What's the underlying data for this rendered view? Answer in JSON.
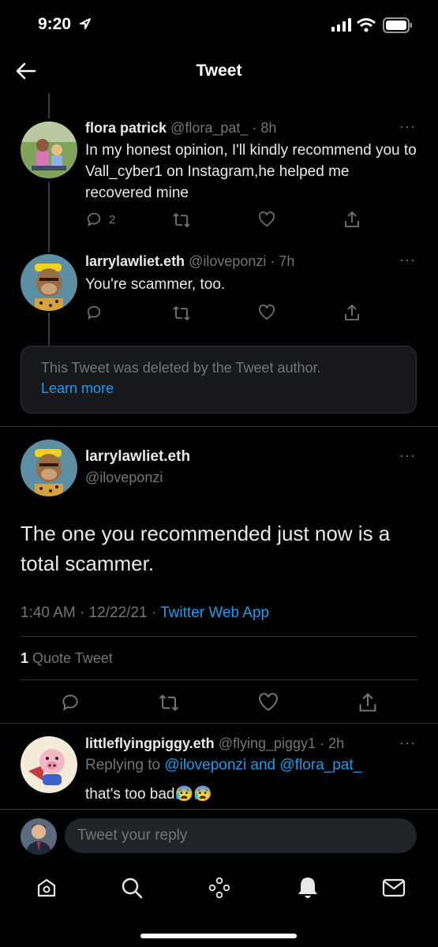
{
  "status": {
    "time": "9:20"
  },
  "header": {
    "title": "Tweet"
  },
  "tweets": [
    {
      "name": "flora patrick",
      "handle": "@flora_pat_",
      "time": "· 8h",
      "body": "In my honest opinion, I'll kindly recommend you to Vall_cyber1 on Instagram,he helped me recovered mine",
      "reply_count": "2"
    },
    {
      "name": "larrylawliet.eth",
      "handle": "@iloveponzi",
      "time": "· 7h",
      "body": "You're scammer, too."
    }
  ],
  "deleted_notice": {
    "text": "This Tweet was deleted by the Tweet author.",
    "link": "Learn more"
  },
  "main_tweet": {
    "name": "larrylawliet.eth",
    "handle": "@iloveponzi",
    "body": "The one you recommended just now is a total scammer.",
    "timestamp": "1:40 AM · 12/22/21 · ",
    "source": "Twitter Web App",
    "quote_count": "1",
    "quote_label": "Quote Tweet"
  },
  "reply_tweet": {
    "name": "littleflyingpiggy.eth",
    "handle": "@flying_piggy1",
    "time": "· 2h",
    "replying_prefix": "Replying to ",
    "replying_to": "@iloveponzi and @flora_pat_",
    "body": "that's too bad",
    "emoji": "😰😰"
  },
  "composer": {
    "placeholder": "Tweet your reply"
  },
  "tabs": [
    "home-icon",
    "search-icon",
    "spaces-icon",
    "notifications-icon",
    "messages-icon"
  ],
  "colors": {
    "accent": "#1d9bf0",
    "muted": "#71767b",
    "background": "#000000"
  }
}
